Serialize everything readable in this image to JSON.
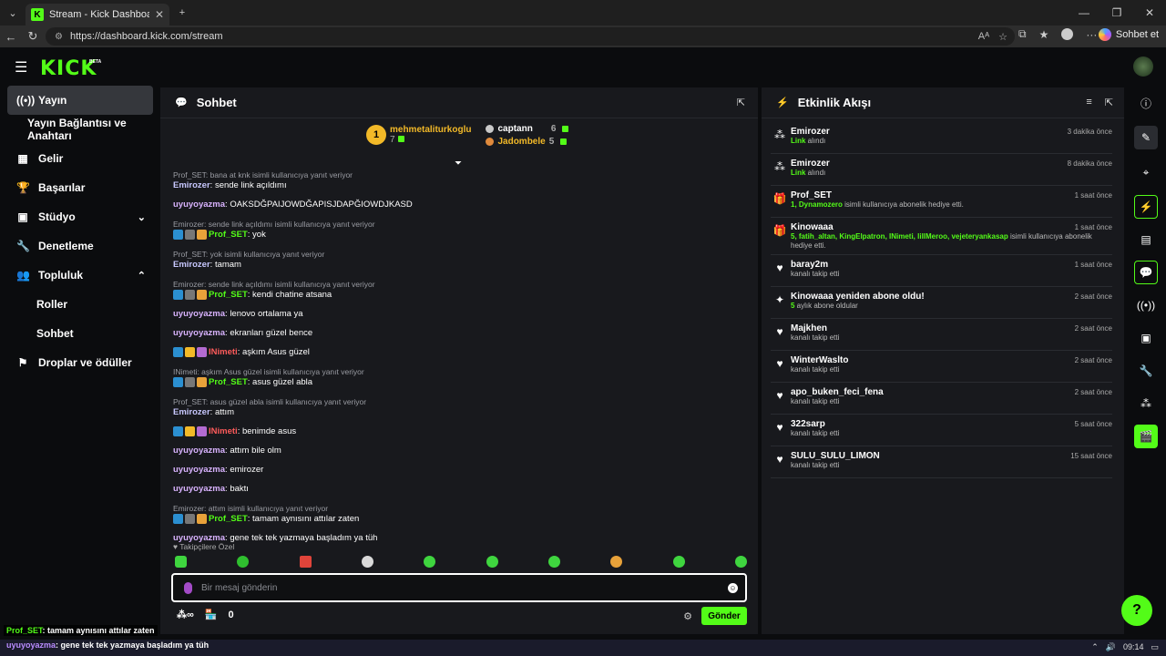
{
  "browser": {
    "tab_title": "Stream - Kick Dashboard",
    "url": "https://dashboard.kick.com/stream",
    "copilot_label": "Sohbet et"
  },
  "brand": {
    "logo": "KICK",
    "beta": "BETA",
    "accent": "#53fc18"
  },
  "sidebar": {
    "items": [
      {
        "label": "Yayın",
        "icon": "broadcast-icon"
      },
      {
        "label": "Yayın Bağlantısı ve Anahtarı"
      },
      {
        "label": "Gelir",
        "icon": "chart-icon"
      },
      {
        "label": "Başarılar",
        "icon": "trophy-icon"
      },
      {
        "label": "Stüdyo",
        "icon": "studio-icon"
      },
      {
        "label": "Denetleme",
        "icon": "wrench-icon"
      },
      {
        "label": "Topluluk",
        "icon": "people-icon"
      },
      {
        "label": "Roller"
      },
      {
        "label": "Sohbet"
      },
      {
        "label": "Droplar ve ödüller",
        "icon": "drops-icon"
      }
    ]
  },
  "chat": {
    "title": "Sohbet",
    "leaderboard": {
      "first_name": "mehmetaliturkoglu",
      "first_count": "7",
      "first_rank": "1",
      "second_name": "captann",
      "second_count": "6",
      "third_name": "Jadombele",
      "third_count": "5"
    },
    "messages": [
      {
        "reply": "Prof_SET: bana at knk isimli kullanıcıya yanıt veriyor",
        "user": "Emirozer",
        "text": "sende link açıldımı"
      },
      {
        "reply": "",
        "user": "uyuyoyazma",
        "text": "OAKSDĞPAIJOWDĞAPISJDAPĞIOWDJKASD"
      },
      {
        "reply": "Emirozer: sende link açıldımı isimli kullanıcıya yanıt veriyor",
        "user": "Prof_SET",
        "text": "yok"
      },
      {
        "reply": "Prof_SET: yok isimli kullanıcıya yanıt veriyor",
        "user": "Emirozer",
        "text": "tamam"
      },
      {
        "reply": "Emirozer: sende link açıldımı isimli kullanıcıya yanıt veriyor",
        "user": "Prof_SET",
        "text": "kendi chatine atsana"
      },
      {
        "reply": "",
        "user": "uyuyoyazma",
        "text": "lenovo ortalama ya"
      },
      {
        "reply": "",
        "user": "uyuyoyazma",
        "text": "ekranları güzel bence"
      },
      {
        "reply": "",
        "user": "INimeti",
        "text": "aşkım Asus güzel"
      },
      {
        "reply": "INimeti: aşkım Asus güzel isimli kullanıcıya yanıt veriyor",
        "user": "Prof_SET",
        "text": "asus güzel abla"
      },
      {
        "reply": "Prof_SET: asus güzel abla isimli kullanıcıya yanıt veriyor",
        "user": "Emirozer",
        "text": "attım"
      },
      {
        "reply": "",
        "user": "INimeti",
        "text": "benimde asus"
      },
      {
        "reply": "",
        "user": "uyuyoyazma",
        "text": "attım bile olm"
      },
      {
        "reply": "",
        "user": "uyuyoyazma",
        "text": "emirozer"
      },
      {
        "reply": "",
        "user": "uyuyoyazma",
        "text": "baktı"
      },
      {
        "reply": "Emirozer: attım isimli kullanıcıya yanıt veriyor",
        "user": "Prof_SET",
        "text": "tamam aynısını attılar zaten"
      },
      {
        "reply": "",
        "user": "uyuyoyazma",
        "text": "gene tek tek yazmaya başladım ya tüh"
      }
    ],
    "followers_label": "Takipçilere Özel",
    "input_placeholder": "Bir mesaj gönderin",
    "points": "0",
    "send_label": "Gönder"
  },
  "activity": {
    "title": "Etkinlik Akışı",
    "items": [
      {
        "name": "Emirozer",
        "hl": "Link",
        "desc": " alındı",
        "time": "3 dakika önce",
        "icon": "drops-icon"
      },
      {
        "name": "Emirozer",
        "hl": "Link",
        "desc": " alındı",
        "time": "8 dakika önce",
        "icon": "drops-icon"
      },
      {
        "name": "Prof_SET",
        "hl": "1, Dynamozero",
        "desc": " isimli kullanıcıya abonelik hediye etti.",
        "time": "1 saat önce",
        "icon": "gift-icon"
      },
      {
        "name": "Kinowaaa",
        "hl": "5, fatih_altan, KingElpatron, INimeti, lillMeroo, vejeteryankasap",
        "desc": " isimli kullanıcıya abonelik hediye etti.",
        "time": "1 saat önce",
        "icon": "gift-icon"
      },
      {
        "name": "baray2m",
        "hl": "",
        "desc": "kanalı takip etti",
        "time": "1 saat önce",
        "icon": "heart-icon"
      },
      {
        "name": "Kinowaaa yeniden abone oldu!",
        "hl": "5",
        "desc": " aylık abone oldular",
        "time": "2 saat önce",
        "icon": "sparkle-icon"
      },
      {
        "name": "Majkhen",
        "hl": "",
        "desc": "kanalı takip etti",
        "time": "2 saat önce",
        "icon": "heart-icon"
      },
      {
        "name": "WinterWaslto",
        "hl": "",
        "desc": "kanalı takip etti",
        "time": "2 saat önce",
        "icon": "heart-icon"
      },
      {
        "name": "apo_buken_feci_fena",
        "hl": "",
        "desc": "kanalı takip etti",
        "time": "2 saat önce",
        "icon": "heart-icon"
      },
      {
        "name": "322sarp",
        "hl": "",
        "desc": "kanalı takip etti",
        "time": "5 saat önce",
        "icon": "heart-icon"
      },
      {
        "name": "SULU_SULU_LIMON",
        "hl": "",
        "desc": "kanalı takip etti",
        "time": "15 saat önce",
        "icon": "heart-icon"
      }
    ]
  },
  "overlay": {
    "line1_user": "Prof_SET",
    "line1_text": ": tamam aynısını attılar zaten",
    "line2_user": "uyuyoyazma",
    "line2_text": ": gene tek tek yazmaya başladım ya tüh"
  },
  "taskbar": {
    "time": "09:14"
  }
}
